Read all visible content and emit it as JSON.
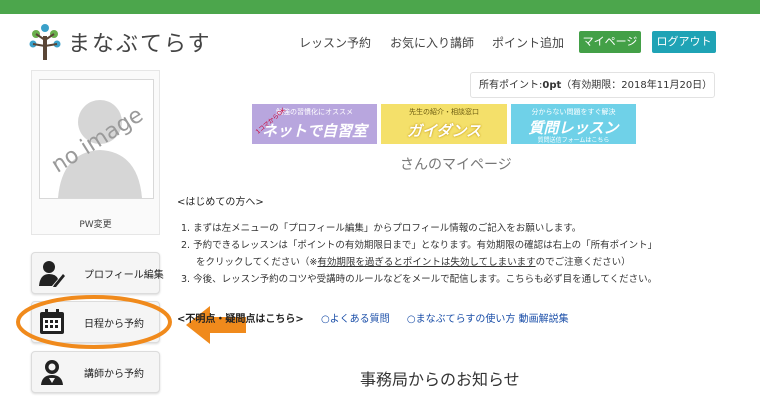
{
  "header": {
    "logo_text": "まなぶてらす",
    "nav": [
      "レッスン予約",
      "お気に入り講師",
      "ポイント追加"
    ],
    "mypage_label": "マイページ",
    "logout_label": "ログアウト"
  },
  "points": {
    "label": "所有ポイント:",
    "value": "0pt",
    "expiry": "（有効期限：2018年11月20日）"
  },
  "banners": [
    {
      "small": "勉強の習慣化にオススメ",
      "big": "ネットで自習室",
      "badge": "1コマからOK"
    },
    {
      "small": "先生の紹介・相談窓口",
      "big": "ガイダンス"
    },
    {
      "small": "分からない問題をすぐ解決",
      "big": "質問レッスン",
      "sub": "質問送信フォームはこちら"
    }
  ],
  "sidebar": {
    "no_image": "no image",
    "pw_change": "PW変更",
    "menu": [
      "プロフィール編集",
      "日程から予約",
      "講師から予約"
    ]
  },
  "main": {
    "page_title": "さんのマイページ",
    "intro_head": "<はじめての方へ>",
    "steps": [
      "1. まずは左メニューの「プロフィール編集」からプロフィール情報のご記入をお願いします。",
      "2. 予約できるレッスンは「ポイントの有効期限日まで」となります。有効期限の確認は右上の「所有ポイント」",
      "をクリックしてください（※",
      "有効期限を過ぎるとポイントは失効してしまいます",
      "のでご注意ください）",
      "3. 今後、レッスン予約のコツや受講時のルールなどをメールで配信します。こちらも必ず目を通してください。"
    ],
    "faq_head": "<不明点・疑問点はこちら>",
    "faq_links": [
      "○よくある質問",
      "○まなぶてらすの使い方 動画解説集"
    ],
    "notice_title": "事務局からのお知らせ"
  },
  "colors": {
    "brand_green": "#4ca64c",
    "mypage_button": "#43a047",
    "logout_button": "#1fa3b5",
    "highlight_orange": "#f08a1c",
    "link_blue": "#1a4ea8"
  }
}
